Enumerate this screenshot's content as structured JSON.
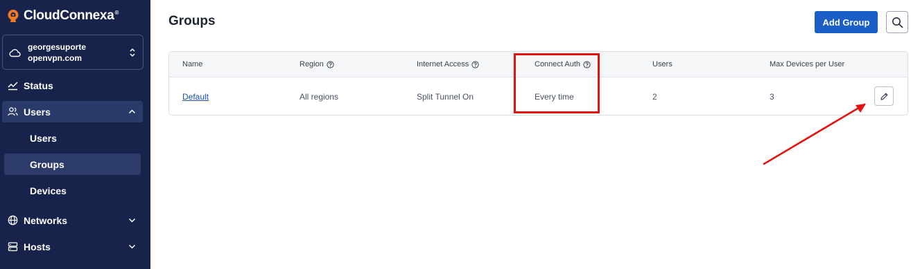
{
  "brand": {
    "name": "CloudConnexa",
    "reg": "®"
  },
  "account": {
    "name": "georgesuporte",
    "domain": "openvpn.com"
  },
  "nav": {
    "status": "Status",
    "users": "Users",
    "users_sub": [
      "Users",
      "Groups",
      "Devices"
    ],
    "networks": "Networks",
    "hosts": "Hosts"
  },
  "page": {
    "title": "Groups",
    "add_button": "Add Group"
  },
  "table": {
    "columns": [
      "Name",
      "Region",
      "Internet Access",
      "Connect Auth",
      "Users",
      "Max Devices per User"
    ],
    "rows": [
      {
        "name": "Default",
        "region": "All regions",
        "internet_access": "Split Tunnel On",
        "connect_auth": "Every time",
        "users": "2",
        "max_devices": "3"
      }
    ]
  },
  "colors": {
    "sidebar": "#17234a",
    "accent": "#1b5ec6",
    "annotation": "#e3130f",
    "brand_logo": "#f07a22"
  },
  "icons": [
    "cloud-icon",
    "status-icon",
    "users-icon",
    "globe-icon",
    "server-icon",
    "search-icon",
    "pencil-icon",
    "help-icon",
    "chevron-icon"
  ]
}
